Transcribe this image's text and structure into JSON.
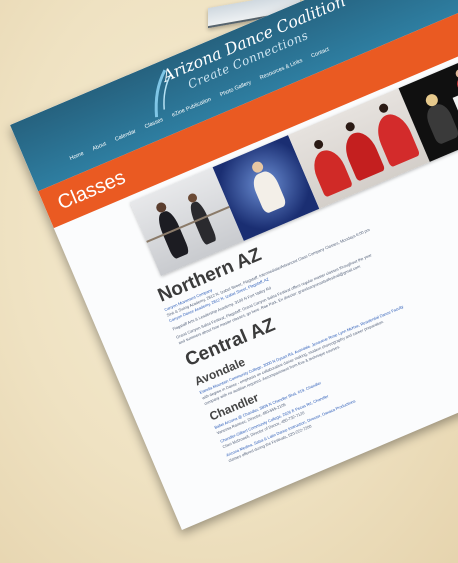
{
  "colors": {
    "header": "#2e7ea1",
    "accent_band": "#ea5a22",
    "background": "#efe2c2",
    "link": "#2b5cb8"
  },
  "site": {
    "logo_title": "Arizona Dance Coalition",
    "logo_tagline": "Create Connections",
    "logo_icon": "dancer-swoosh-icon"
  },
  "nav": {
    "items": [
      "Home",
      "About",
      "Calendar",
      "Classes",
      "eZine Publication",
      "Photo Gallery",
      "Resources & Links",
      "Contact"
    ]
  },
  "page": {
    "title": "Classes"
  },
  "photos": [
    {
      "subject": "ballet barre class"
    },
    {
      "subject": "child dancer in blue"
    },
    {
      "subject": "flamenco dancers in red"
    },
    {
      "subject": "pianist accompanist"
    }
  ],
  "sections": {
    "northern": {
      "heading": "Northern AZ",
      "lines": [
        "Canyon Movement Company",
        "Sink & Swing Academy, 2812 N. Izabel Street, Flagstaff. Intermediate/Advanced Class Company Classes, Mondays 6:00 pm",
        "Canyon Dance Academy, 2812 N. Izabel Street, Flagstaff, AZ",
        "Flagstaff Arts & Leadership Academy, 3100 N Fort Valley Rd",
        "Grand Canyon Salsa Festival, Flagstaff: Grand Canyon Salsa Festival offers regular master classes throughout the year",
        "and summers about how master classes, go here. Rae Park. Ex director: grandcanyonsalsafestival@gmail.com"
      ]
    },
    "central": {
      "heading": "Central AZ",
      "subheadings": {
        "avondale": "Avondale",
        "chandler": "Chandler"
      },
      "avondale_lines": [
        "Estrella Mountain Community College, 3000 N Dysart Rd, Avondale. Jenaveve Rose Lynn McKee, Residential Dance Faculty",
        "with degree in Dance - emphasis on collaborative dance making, modern choreography and career preparation.",
        "company with no audition required. Accompaniment from Eve & technique courses."
      ],
      "chandler_lines": [
        "Ballet Arizona @ Chandler, 3805 N Chandler Blvd, #19, Chandler",
        "Vanessa Ramirez, Director, 480-555-2105",
        "Chandler-Gilbert Community College, 2626 E Pecos Rd, Chandler",
        "Cheri McDowell, Director of Dance, 480-732-7120",
        "Arizona Medina, Salsa & Latin Dance Instruction, Director, Oaxaca Productions",
        "classes offered during the Festivals, 520-222-7200"
      ]
    }
  }
}
